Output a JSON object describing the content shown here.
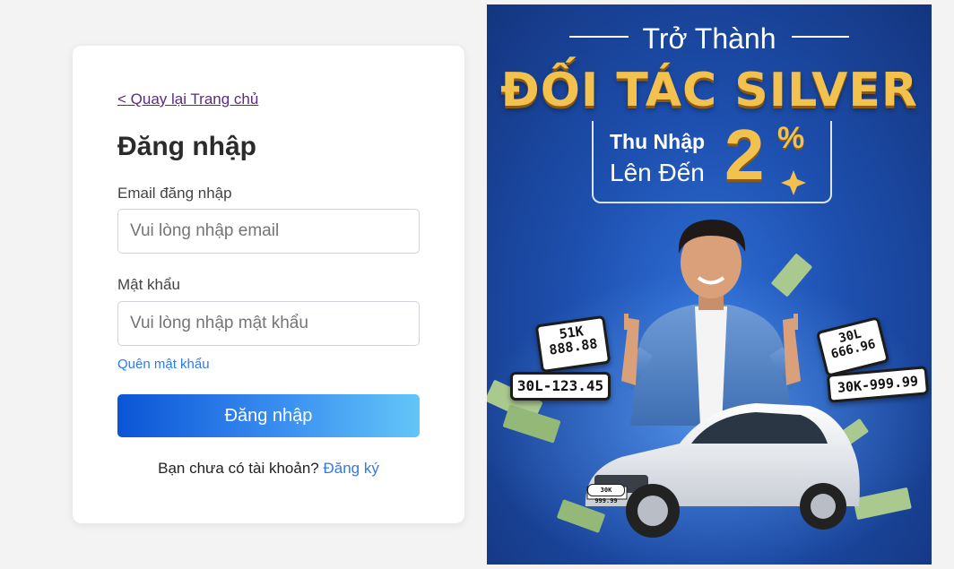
{
  "login": {
    "back_link": "< Quay lại Trang chủ",
    "title": "Đăng nhập",
    "email_label": "Email đăng nhập",
    "email_placeholder": "Vui lòng nhập email",
    "password_label": "Mật khẩu",
    "password_placeholder": "Vui lòng nhập mật khẩu",
    "forgot_password": "Quên mật khẩu",
    "submit_label": "Đăng nhập",
    "no_account_text": "Bạn chưa có tài khoản?",
    "signup_link": "Đăng ký"
  },
  "banner": {
    "become": "Trở Thành",
    "partner": "ĐỐI TÁC SILVER",
    "income_line1": "Thu Nhập",
    "income_line2": "Lên Đến",
    "percent_value": "2",
    "percent_sign": "%",
    "plates": [
      {
        "line1": "51K",
        "line2": "888.88"
      },
      {
        "line1": "30L-123.45"
      },
      {
        "line1": "30L",
        "line2": "666.96"
      },
      {
        "line1": "30K-999.99"
      }
    ],
    "car_plate": "30K 999.99"
  },
  "colors": {
    "accent_link": "#2f7be5",
    "back_link": "#5b2a86",
    "button_gradient_start": "#0a55d6",
    "button_gradient_end": "#62c6f7",
    "banner_blue": "#1d4fae",
    "banner_gold": "#f2c14e"
  }
}
